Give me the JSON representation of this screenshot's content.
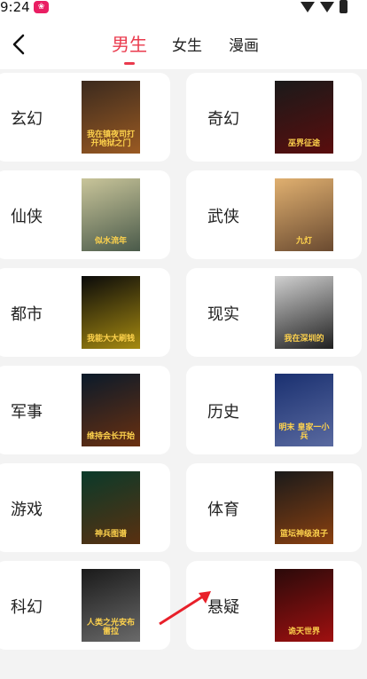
{
  "status": {
    "time": "9:24"
  },
  "tabs": [
    {
      "label": "男生"
    },
    {
      "label": "女生"
    },
    {
      "label": "漫画"
    }
  ],
  "categories": [
    {
      "name": "玄幻",
      "cover_title": "我在镇夜司打开地狱之门",
      "cover_colors": [
        "#3b2a1e",
        "#9a5a22"
      ]
    },
    {
      "name": "奇幻",
      "cover_title": "巫界征途",
      "cover_colors": [
        "#1a1a1a",
        "#5a0d0d"
      ]
    },
    {
      "name": "仙侠",
      "cover_title": "似水流年",
      "cover_colors": [
        "#c9c59a",
        "#4a5a4a"
      ]
    },
    {
      "name": "武侠",
      "cover_title": "九灯",
      "cover_colors": [
        "#e0b070",
        "#6a4a30"
      ]
    },
    {
      "name": "都市",
      "cover_title": "我能大大刷钱",
      "cover_colors": [
        "#0a0a0a",
        "#a68a10"
      ]
    },
    {
      "name": "现实",
      "cover_title": "我在深圳的",
      "cover_colors": [
        "#d0d0d0",
        "#202020"
      ]
    },
    {
      "name": "军事",
      "cover_title": "维持会长开始",
      "cover_colors": [
        "#0a1a2a",
        "#6a3010"
      ]
    },
    {
      "name": "历史",
      "cover_title": "明末 皇家一小兵",
      "cover_colors": [
        "#1a3070",
        "#5a6aa0"
      ]
    },
    {
      "name": "游戏",
      "cover_title": "神兵图谱",
      "cover_colors": [
        "#0a3a2a",
        "#5a3010"
      ]
    },
    {
      "name": "体育",
      "cover_title": "篮坛神级浪子",
      "cover_colors": [
        "#1a1a1a",
        "#8a4010"
      ]
    },
    {
      "name": "科幻",
      "cover_title": "人类之光安布雷拉",
      "cover_colors": [
        "#1a1a1a",
        "#6a6a6a"
      ]
    },
    {
      "name": "悬疑",
      "cover_title": "诡天世界",
      "cover_colors": [
        "#2a0a0a",
        "#a01010"
      ]
    }
  ]
}
